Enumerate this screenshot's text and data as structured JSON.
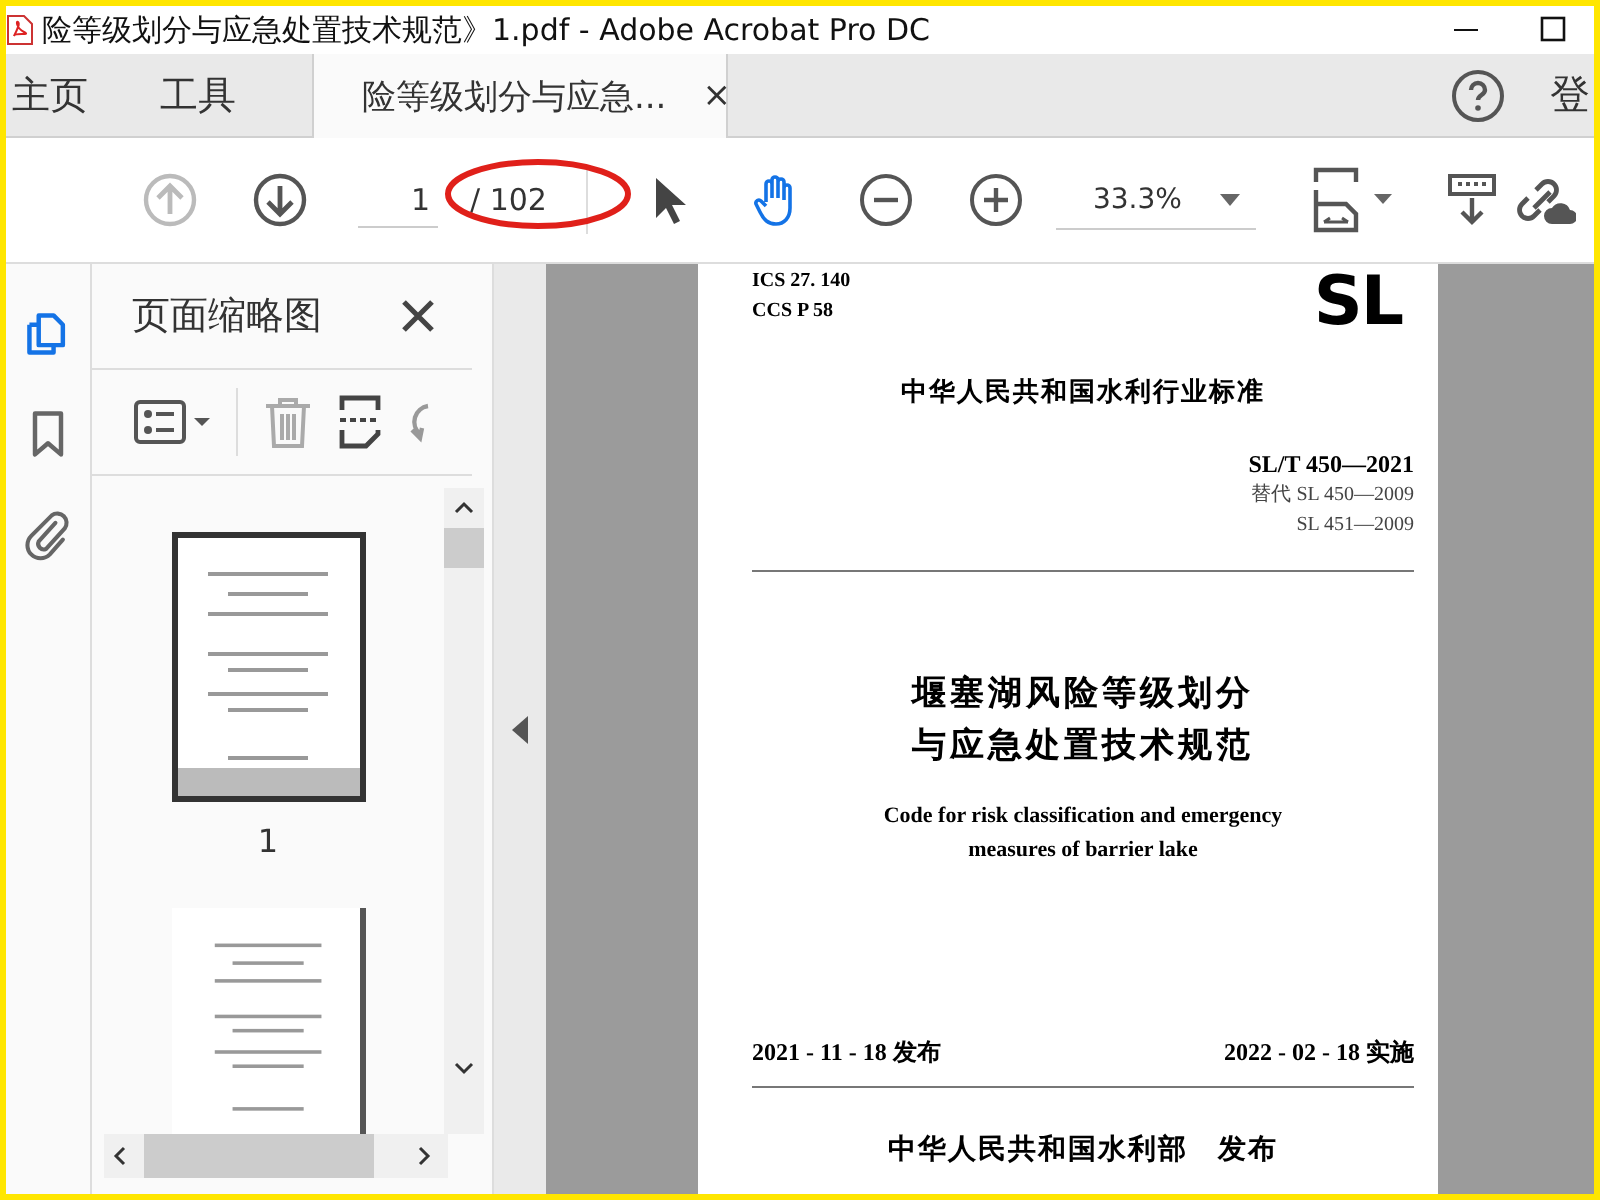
{
  "window": {
    "title": "险等级划分与应急处置技术规范》1.pdf - Adobe Acrobat Pro DC"
  },
  "tabs": [
    {
      "label": "主页",
      "selected": false
    },
    {
      "label": "工具",
      "selected": false
    },
    {
      "label": "险等级划分与应急...",
      "selected": true,
      "close": "×"
    }
  ],
  "account": {
    "sign_in": "登"
  },
  "toolbar": {
    "navigation": [
      {
        "kind": "up",
        "disabled": true
      },
      {
        "kind": "down",
        "disabled": false
      }
    ],
    "page_number": "1",
    "page_total": "/ 102",
    "tools": [
      {
        "kind": "pointer",
        "selected": false
      },
      {
        "kind": "hand",
        "selected": true
      }
    ],
    "zoom": "33.3%"
  },
  "side_rail": [
    {
      "kind": "pages",
      "selected": true
    },
    {
      "kind": "bookmarks",
      "selected": false
    },
    {
      "kind": "attachments",
      "selected": false
    }
  ],
  "panel": {
    "title": "页面缩略图",
    "thumbnails": [
      {
        "label": "1",
        "selected": true
      },
      {
        "selected": false
      }
    ]
  },
  "document": {
    "header_codes": [
      "ICS 27. 140",
      "CCS P 58"
    ],
    "logo": "SL",
    "category": "中华人民共和国水利行业标准",
    "standard_number": "SL/T 450—2021",
    "replaces": [
      "替代 SL 450—2009",
      "SL 451—2009"
    ],
    "title_lines": [
      "堰塞湖风险等级划分",
      "与应急处置技术规范"
    ],
    "english_lines": [
      "Code for risk classification and emergency",
      "measures of barrier lake"
    ],
    "issued": "2021 - 11 - 18 发布",
    "effective": "2022 - 02 - 18 实施",
    "publisher": "中华人民共和国水利部　发布"
  }
}
